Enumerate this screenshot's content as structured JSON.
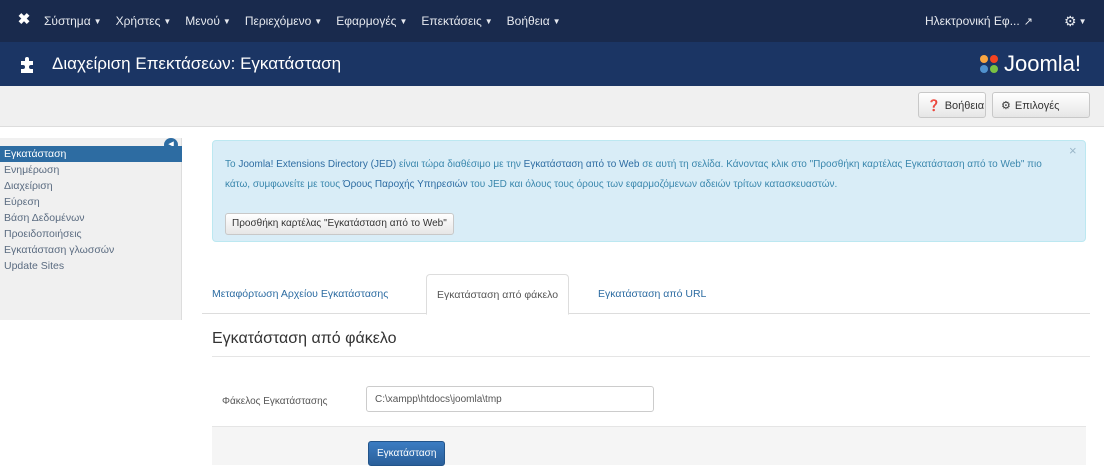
{
  "topbar": {
    "logo_icon": "joomla-x-icon",
    "menu": [
      {
        "label": "Σύστημα"
      },
      {
        "label": "Χρήστες"
      },
      {
        "label": "Μενού"
      },
      {
        "label": "Περιεχόμενο"
      },
      {
        "label": "Εφαρμογές"
      },
      {
        "label": "Επεκτάσεις"
      },
      {
        "label": "Βοήθεια"
      }
    ],
    "user_label": "Ηλεκτρονική Εφ...",
    "external_icon": "external-link-icon",
    "settings_icon": "gear-icon"
  },
  "titlebar": {
    "title": "Διαχείριση Επεκτάσεων: Εγκατάσταση",
    "brand": "Joomla!",
    "accent": "#f9a541"
  },
  "toolbar": {
    "help_label": "Βοήθεια",
    "options_label": "Επιλογές"
  },
  "sidebar": {
    "items": [
      {
        "label": "Εγκατάσταση",
        "active": true
      },
      {
        "label": "Ενημέρωση"
      },
      {
        "label": "Διαχείριση"
      },
      {
        "label": "Εύρεση"
      },
      {
        "label": "Βάση Δεδομένων"
      },
      {
        "label": "Προειδοποιήσεις"
      },
      {
        "label": "Εγκατάσταση γλωσσών"
      },
      {
        "label": "Update Sites"
      }
    ]
  },
  "alert": {
    "t1": "Το ",
    "link_jed": "Joomla! Extensions Directory (JED)",
    "t2": " είναι τώρα διαθέσιμο με την ",
    "link_web": "Εγκατάσταση από το Web",
    "t3": " σε αυτή τη σελίδα. Κάνοντας κλικ στο \"Προσθήκη καρτέλας Εγκατάσταση από το Web\" πιο κάτω, συμφωνείτε με τους ",
    "link_tos": "Όρους Παροχής Υπηρεσιών",
    "t4": " του JED και όλους τους όρους των εφαρμοζόμενων αδειών τρίτων κατασκευαστών.",
    "button_label": "Προσθήκη καρτέλας \"Εγκατάσταση από το Web\""
  },
  "tabs": [
    {
      "label": "Μεταφόρτωση Αρχείου Εγκατάστασης"
    },
    {
      "label": "Εγκατάσταση από φάκελο",
      "active": true
    },
    {
      "label": "Εγκατάσταση από URL"
    }
  ],
  "form": {
    "heading": "Εγκατάσταση από φάκελο",
    "field_label": "Φάκελος Εγκατάστασης",
    "field_value": "C:\\xampp\\htdocs\\joomla\\tmp",
    "install_label": "Εγκατάσταση"
  },
  "colors": {
    "topbar": "#192a4d",
    "titlebar": "#1b3564",
    "link": "#2d6ca2",
    "alert_bg": "#d9edf7"
  }
}
